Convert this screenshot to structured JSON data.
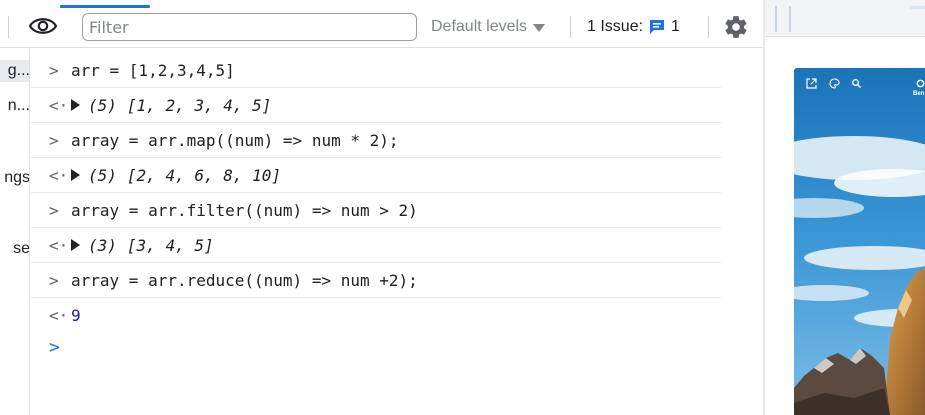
{
  "toolbar": {
    "filter_placeholder": "Filter",
    "levels_label": "Default levels",
    "issues_label": "1 Issue:",
    "issues_count": "1",
    "accent_color": "#1a73e8"
  },
  "sidebar": {
    "items": [
      {
        "label": "g..."
      },
      {
        "label": "n..."
      },
      {
        "label": "ngs"
      },
      {
        "label": "se"
      }
    ]
  },
  "console": {
    "prompt_input": ">",
    "prompt_output": "<·",
    "entries": [
      {
        "type": "input",
        "text": "arr = [1,2,3,4,5]"
      },
      {
        "type": "output",
        "count": "(5)",
        "text": "[1, 2, 3, 4, 5]"
      },
      {
        "type": "input",
        "text": "array = arr.map((num) => num * 2);"
      },
      {
        "type": "output",
        "count": "(5)",
        "text": "[2, 4, 6, 8, 10]"
      },
      {
        "type": "input",
        "text": "array = arr.filter((num) => num > 2)"
      },
      {
        "type": "output",
        "count": "(3)",
        "text": "[3, 4, 5]"
      },
      {
        "type": "input",
        "text": "array = arr.reduce((num) => num +2);"
      },
      {
        "type": "output",
        "text": "9"
      }
    ],
    "active_prompt": ">"
  },
  "preview": {
    "label": "Ben",
    "icons": [
      "external-link-icon",
      "palette-icon",
      "search-icon",
      "settings-icon"
    ]
  }
}
